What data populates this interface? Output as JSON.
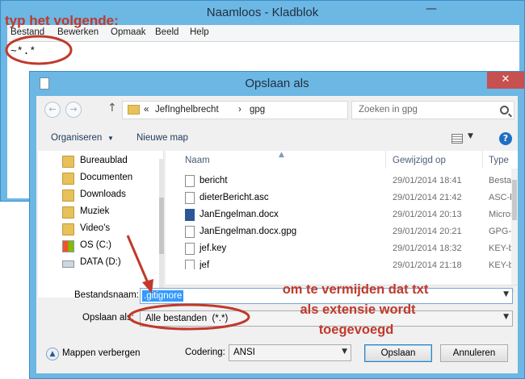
{
  "notepad": {
    "title": "Naamloos - Kladblok",
    "minimize_glyph": "—",
    "menu": [
      "Bestand",
      "Bewerken",
      "Opmaak",
      "Beeld",
      "Help"
    ],
    "content": "~*.*"
  },
  "dialog": {
    "title": "Opslaan als",
    "close_glyph": "✕",
    "nav": {
      "back": "←",
      "forward": "→",
      "up": "↑"
    },
    "address": [
      "«",
      "JefInghelbrecht",
      "›",
      "gpg"
    ],
    "search_placeholder": "Zoeken in gpg",
    "toolbar": {
      "organize": "Organiseren",
      "organize_arrow": "▼",
      "new_folder": "Nieuwe map",
      "view_arrow": "▼",
      "help": "?"
    },
    "nav_pane": [
      {
        "label": "Bureaublad",
        "icon": "folder-icon"
      },
      {
        "label": "Documenten",
        "icon": "folder-icon"
      },
      {
        "label": "Downloads",
        "icon": "folder-icon"
      },
      {
        "label": "Muziek",
        "icon": "folder-icon"
      },
      {
        "label": "Video's",
        "icon": "folder-icon"
      },
      {
        "label": "OS (C:)",
        "icon": "drive-icon"
      },
      {
        "label": "DATA (D:)",
        "icon": "drive-icon"
      }
    ],
    "columns": {
      "name": "Naam",
      "modified": "Gewijzigd op",
      "type": "Type",
      "sort_arrow": "▲"
    },
    "files": [
      {
        "name": "bericht",
        "date": "29/01/2014 18:41",
        "type": "Bestan",
        "icon": "file-icon"
      },
      {
        "name": "dieterBericht.asc",
        "date": "29/01/2014 21:42",
        "type": "ASC-b",
        "icon": "file-icon"
      },
      {
        "name": "JanEngelman.docx",
        "date": "29/01/2014 20:13",
        "type": "Micros",
        "icon": "word-icon"
      },
      {
        "name": "JanEngelman.docx.gpg",
        "date": "29/01/2014 20:21",
        "type": "GPG-b",
        "icon": "file-icon"
      },
      {
        "name": "jef.key",
        "date": "29/01/2014 18:32",
        "type": "KEY-b",
        "icon": "file-icon"
      },
      {
        "name": "jef",
        "date": "29/01/2014 21:18",
        "type": "KEY-b",
        "icon": "file-icon"
      }
    ],
    "scroll_arrows": {
      "left": "◀",
      "right": "▶",
      "dropdown": "▼"
    },
    "filename_label": "Bestandsnaam:",
    "filename_value": ".gitignore",
    "filetype_label": "Opslaan als:",
    "filetype_value": "Alle bestanden  (*.*)",
    "hide_folders": "Mappen verbergen",
    "hide_glyph": "▲",
    "encoding_label": "Codering:",
    "encoding_value": "ANSI",
    "save_button": "Opslaan",
    "cancel_button": "Annuleren"
  },
  "annotations": {
    "top": "typ het volgende:",
    "bottom": [
      "om te vermijden dat txt",
      "als extensie wordt",
      "toegevoegd"
    ],
    "color": "#c0392b"
  }
}
